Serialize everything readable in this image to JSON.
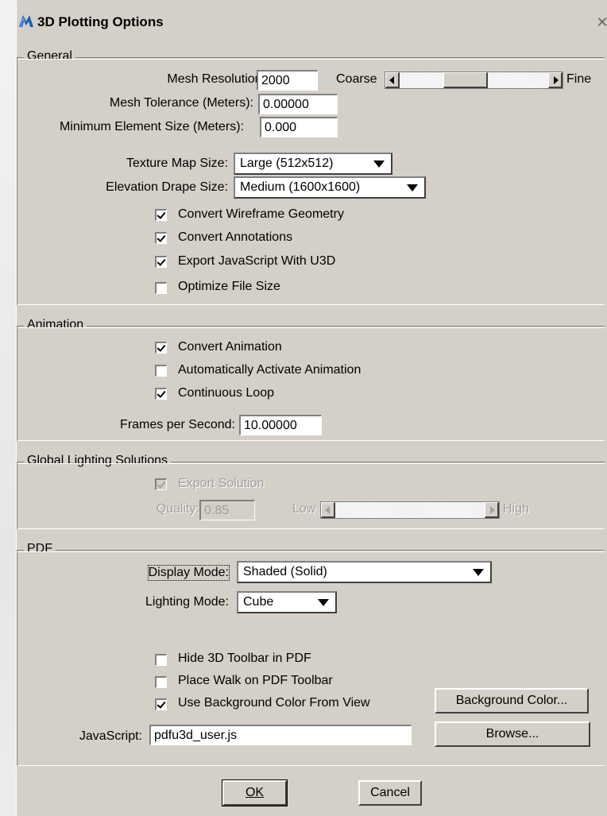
{
  "window": {
    "title": "3D Plotting Options",
    "icon": "microstation-icon",
    "close_label": "✕"
  },
  "general": {
    "legend": "General",
    "mesh_resolution": {
      "label": "Mesh Resolution:",
      "value": "2000"
    },
    "resolution_slider": {
      "min_label": "Coarse",
      "max_label": "Fine",
      "position": 0.42
    },
    "mesh_tolerance": {
      "label": "Mesh Tolerance (Meters):",
      "value": "0.00000"
    },
    "min_element_size": {
      "label": "Minimum Element Size (Meters):",
      "value": "0.000"
    },
    "texture_map_size": {
      "label": "Texture Map Size:",
      "value": "Large (512x512)"
    },
    "elevation_drape_size": {
      "label": "Elevation Drape Size:",
      "value": "Medium (1600x1600)"
    },
    "checkboxes": [
      {
        "label": "Convert Wireframe Geometry",
        "checked": true
      },
      {
        "label": "Convert Annotations",
        "checked": true
      },
      {
        "label": "Export JavaScript With U3D",
        "checked": true
      },
      {
        "label": "Optimize File Size",
        "checked": false
      }
    ]
  },
  "animation": {
    "legend": "Animation",
    "checkboxes": [
      {
        "label": "Convert Animation",
        "checked": true
      },
      {
        "label": "Automatically Activate Animation",
        "checked": false
      },
      {
        "label": "Continuous Loop",
        "checked": true
      }
    ],
    "fps": {
      "label": "Frames per Second:",
      "value": "10.00000"
    }
  },
  "lighting": {
    "legend": "Global Lighting Solutions",
    "export_solution": {
      "label": "Export Solution",
      "checked": true,
      "enabled": false
    },
    "quality": {
      "label": "Quality:",
      "value": "0.85"
    },
    "quality_slider": {
      "min_label": "Low",
      "max_label": "High",
      "position": 0.0
    }
  },
  "pdf": {
    "legend": "PDF",
    "display_mode": {
      "label": "Display Mode:",
      "value": "Shaded (Solid)"
    },
    "lighting_mode": {
      "label": "Lighting Mode:",
      "value": "Cube"
    },
    "checkboxes": [
      {
        "label": "Hide 3D Toolbar in PDF",
        "checked": false
      },
      {
        "label": "Place Walk on PDF Toolbar",
        "checked": false
      },
      {
        "label": "Use Background Color From View",
        "checked": true
      }
    ],
    "background_color_button": "Background Color...",
    "javascript": {
      "label": "JavaScript:",
      "value": "pdfu3d_user.js"
    },
    "browse_button": "Browse..."
  },
  "footer": {
    "ok_label": "OK",
    "cancel_label": "Cancel"
  },
  "colors": {
    "dialog_bg": "#d4d0c8",
    "field_bg": "#ffffff",
    "disabled_text": "#a0a0a0",
    "icon_blue": "#1a5fb4"
  }
}
